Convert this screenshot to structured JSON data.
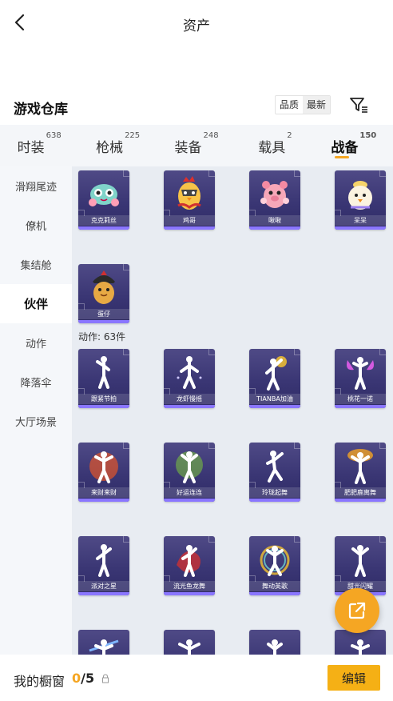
{
  "header": {
    "title": "资产"
  },
  "warehouse": {
    "title": "游戏仓库",
    "sort_options": [
      "品质",
      "最新"
    ]
  },
  "tabs": [
    {
      "label": "时装",
      "count": "638"
    },
    {
      "label": "枪械",
      "count": "225"
    },
    {
      "label": "装备",
      "count": "248"
    },
    {
      "label": "载具",
      "count": "2"
    },
    {
      "label": "战备",
      "count": "150"
    }
  ],
  "sidebar": {
    "items": [
      "滑翔尾迹",
      "僚机",
      "集结舱",
      "伙伴",
      "动作",
      "降落伞",
      "大厅场景"
    ]
  },
  "partners": {
    "items": [
      "克克莉丝",
      "鸡哥",
      "啾啾",
      "呆呆",
      "蛋仔"
    ]
  },
  "actions": {
    "section_label": "动作: 63件",
    "items": [
      "跟紧节拍",
      "龙虾慢摇",
      "TIANBA加油",
      "桃花一诺",
      "来财来财",
      "好运连连",
      "玲珑起舞",
      "肥肥鹿离舞",
      "派对之星",
      "流光鱼龙舞",
      "舞动英歌",
      "甜光闪耀"
    ]
  },
  "bottom_bar": {
    "label": "我的橱窗",
    "current": "0",
    "total": "/5",
    "edit_label": "编辑"
  },
  "colors": {
    "accent": "#f5a623",
    "card_bg": "#3a3674",
    "card_strip": "#8a76ff"
  }
}
